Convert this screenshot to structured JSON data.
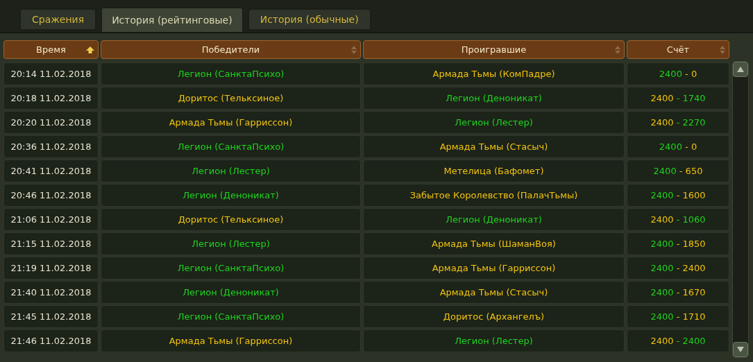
{
  "tabs": [
    {
      "label": "Сражения",
      "selected": false
    },
    {
      "label": "История (рейтинговые)",
      "selected": true
    },
    {
      "label": "История (обычные)",
      "selected": false
    }
  ],
  "table": {
    "columns": [
      {
        "label": "Время",
        "sorted": true
      },
      {
        "label": "Победители",
        "sorted": false
      },
      {
        "label": "Проигравшие",
        "sorted": false
      },
      {
        "label": "Счёт",
        "sorted": false
      }
    ],
    "rows": [
      {
        "time": "20:14 11.02.2018",
        "winner": {
          "name": "Легион (СанктаПсихо)",
          "color": "#1ed41e"
        },
        "loser": {
          "name": "Армада Тьмы (КомПадре)",
          "color": "#f2c40f"
        },
        "winner_score": "2400",
        "loser_score": "- 0"
      },
      {
        "time": "20:18 11.02.2018",
        "winner": {
          "name": "Доритос (Тельксиное)",
          "color": "#f2c40f"
        },
        "loser": {
          "name": "Легион (Деноникат)",
          "color": "#1ed41e"
        },
        "winner_score": "2400",
        "loser_score": "- 1740"
      },
      {
        "time": "20:20 11.02.2018",
        "winner": {
          "name": "Армада Тьмы (Гарриссон)",
          "color": "#f2c40f"
        },
        "loser": {
          "name": "Легион (Лестер)",
          "color": "#1ed41e"
        },
        "winner_score": "2400",
        "loser_score": "- 2270"
      },
      {
        "time": "20:36 11.02.2018",
        "winner": {
          "name": "Легион (СанктаПсихо)",
          "color": "#1ed41e"
        },
        "loser": {
          "name": "Армада Тьмы (Стасыч)",
          "color": "#f2c40f"
        },
        "winner_score": "2400",
        "loser_score": "- 0"
      },
      {
        "time": "20:41 11.02.2018",
        "winner": {
          "name": "Легион (Лестер)",
          "color": "#1ed41e"
        },
        "loser": {
          "name": "Метелица (Бафомет)",
          "color": "#f2c40f"
        },
        "winner_score": "2400",
        "loser_score": "- 650"
      },
      {
        "time": "20:46 11.02.2018",
        "winner": {
          "name": "Легион (Деноникат)",
          "color": "#1ed41e"
        },
        "loser": {
          "name": "Забытое Королевство (ПалачТьмы)",
          "color": "#f2c40f"
        },
        "winner_score": "2400",
        "loser_score": "- 1600"
      },
      {
        "time": "21:06 11.02.2018",
        "winner": {
          "name": "Доритос (Тельксиное)",
          "color": "#f2c40f"
        },
        "loser": {
          "name": "Легион (Деноникат)",
          "color": "#1ed41e"
        },
        "winner_score": "2400",
        "loser_score": "- 1060"
      },
      {
        "time": "21:15 11.02.2018",
        "winner": {
          "name": "Легион (Лестер)",
          "color": "#1ed41e"
        },
        "loser": {
          "name": "Армада Тьмы (ШаманВоя)",
          "color": "#f2c40f"
        },
        "winner_score": "2400",
        "loser_score": "- 1850"
      },
      {
        "time": "21:19 11.02.2018",
        "winner": {
          "name": "Легион (СанктаПсихо)",
          "color": "#1ed41e"
        },
        "loser": {
          "name": "Армада Тьмы (Гарриссон)",
          "color": "#f2c40f"
        },
        "winner_score": "2400",
        "loser_score": "- 2400"
      },
      {
        "time": "21:40 11.02.2018",
        "winner": {
          "name": "Легион (Деноникат)",
          "color": "#1ed41e"
        },
        "loser": {
          "name": "Армада Тьмы (Стасыч)",
          "color": "#f2c40f"
        },
        "winner_score": "2400",
        "loser_score": "- 1670"
      },
      {
        "time": "21:45 11.02.2018",
        "winner": {
          "name": "Легион (СанктаПсихо)",
          "color": "#1ed41e"
        },
        "loser": {
          "name": "Доритос (Архангелъ)",
          "color": "#f2c40f"
        },
        "winner_score": "2400",
        "loser_score": "- 1710"
      },
      {
        "time": "21:46 11.02.2018",
        "winner": {
          "name": "Армада Тьмы (Гарриссон)",
          "color": "#f2c40f"
        },
        "loser": {
          "name": "Легион (Лестер)",
          "color": "#1ed41e"
        },
        "winner_score": "2400",
        "loser_score": "- 2400"
      }
    ]
  }
}
